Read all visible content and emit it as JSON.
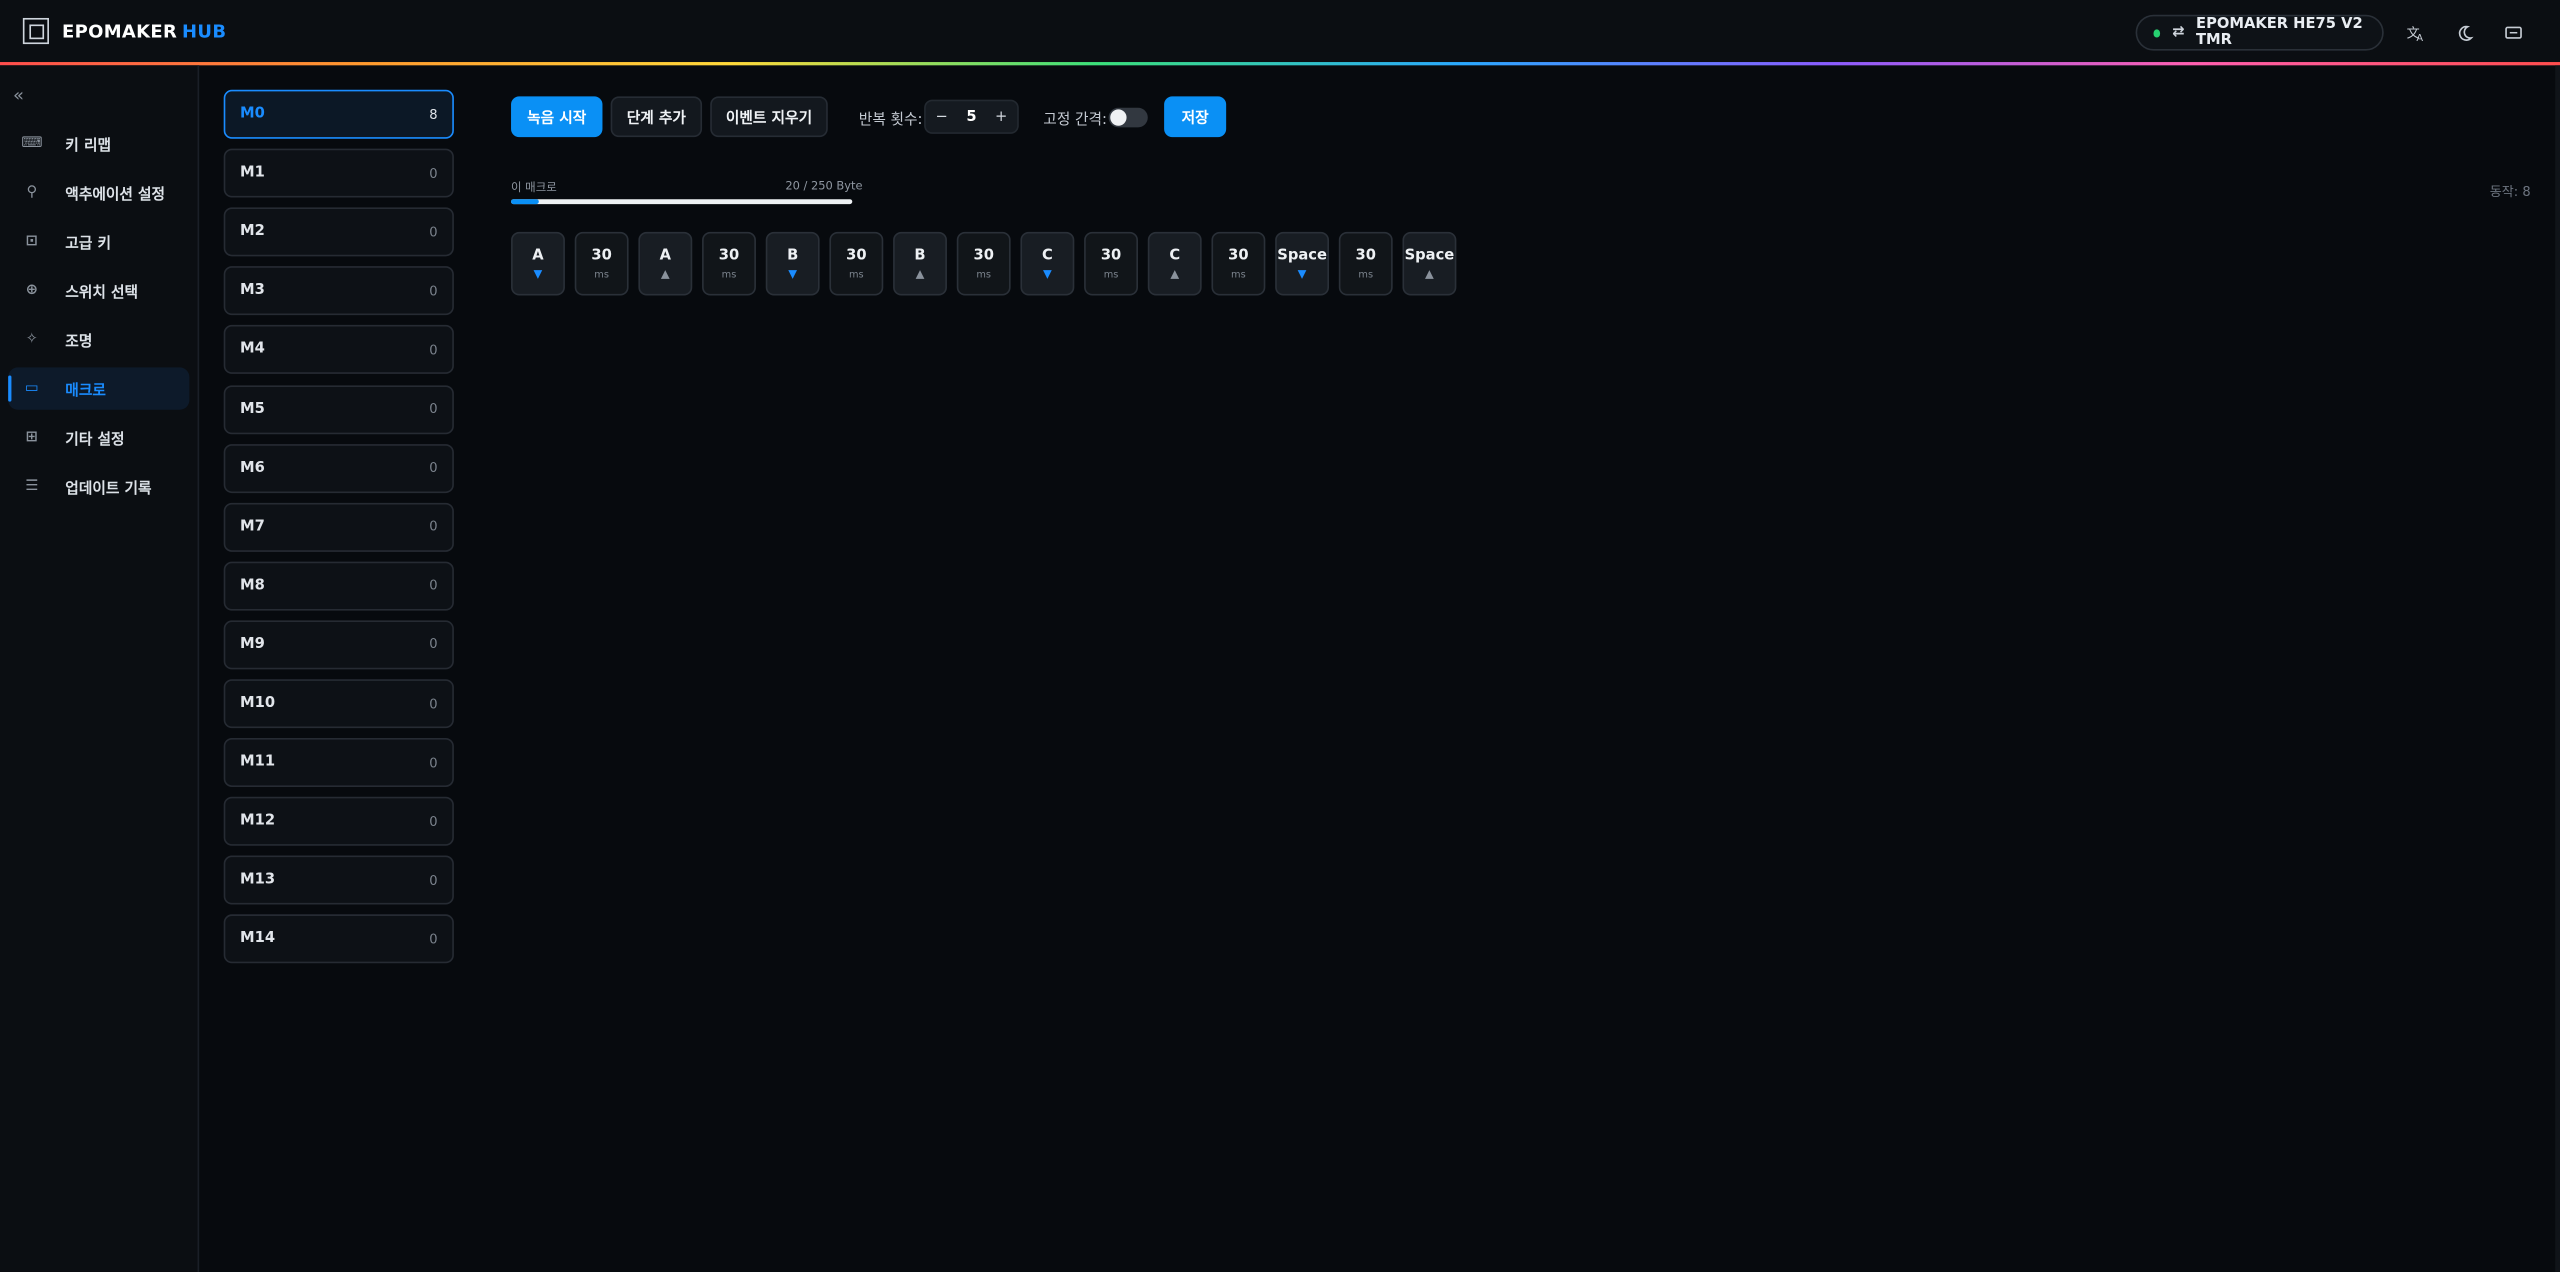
{
  "app": {
    "brand": "EPOMAKER",
    "brand_suffix": "HUB",
    "device_name": "EPOMAKER HE75 V2 TMR"
  },
  "sidebar": {
    "items": [
      {
        "label": "키 리맵",
        "icon": "keyboard-icon"
      },
      {
        "label": "액추에이션 설정",
        "icon": "actuation-icon"
      },
      {
        "label": "고급 키",
        "icon": "advanced-key-icon"
      },
      {
        "label": "스위치 선택",
        "icon": "switch-icon"
      },
      {
        "label": "조명",
        "icon": "bulb-icon"
      },
      {
        "label": "매크로",
        "icon": "macro-icon",
        "active": true
      },
      {
        "label": "기타 설정",
        "icon": "grid-icon"
      },
      {
        "label": "업데이트 기록",
        "icon": "document-icon"
      }
    ]
  },
  "macros": [
    {
      "name": "M0",
      "count": "8"
    },
    {
      "name": "M1",
      "count": "0"
    },
    {
      "name": "M2",
      "count": "0"
    },
    {
      "name": "M3",
      "count": "0"
    },
    {
      "name": "M4",
      "count": "0"
    },
    {
      "name": "M5",
      "count": "0"
    },
    {
      "name": "M6",
      "count": "0"
    },
    {
      "name": "M7",
      "count": "0"
    },
    {
      "name": "M8",
      "count": "0"
    },
    {
      "name": "M9",
      "count": "0"
    },
    {
      "name": "M10",
      "count": "0"
    },
    {
      "name": "M11",
      "count": "0"
    },
    {
      "name": "M12",
      "count": "0"
    },
    {
      "name": "M13",
      "count": "0"
    },
    {
      "name": "M14",
      "count": "0"
    }
  ],
  "toolbar": {
    "record_label": "녹음 시작",
    "add_step_label": "단계 추가",
    "clear_events_label": "이벤트 지우기",
    "repeat_label": "반복 횟수:",
    "repeat_value": "5",
    "fixed_interval_label": "고정 간격:",
    "fixed_interval_on": false,
    "save_label": "저장"
  },
  "capacity": {
    "label": "이 매크로",
    "usage_text": "20 / 250 Byte",
    "used": 20,
    "total": 250
  },
  "action_count_text": "동작: 8",
  "events": [
    {
      "type": "key",
      "key": "A",
      "dir": "down"
    },
    {
      "type": "delay",
      "value": "30",
      "unit": "ms"
    },
    {
      "type": "key",
      "key": "A",
      "dir": "up"
    },
    {
      "type": "delay",
      "value": "30",
      "unit": "ms"
    },
    {
      "type": "key",
      "key": "B",
      "dir": "down"
    },
    {
      "type": "delay",
      "value": "30",
      "unit": "ms"
    },
    {
      "type": "key",
      "key": "B",
      "dir": "up"
    },
    {
      "type": "delay",
      "value": "30",
      "unit": "ms"
    },
    {
      "type": "key",
      "key": "C",
      "dir": "down"
    },
    {
      "type": "delay",
      "value": "30",
      "unit": "ms"
    },
    {
      "type": "key",
      "key": "C",
      "dir": "up"
    },
    {
      "type": "delay",
      "value": "30",
      "unit": "ms"
    },
    {
      "type": "key",
      "key": "Space",
      "dir": "down"
    },
    {
      "type": "delay",
      "value": "30",
      "unit": "ms"
    },
    {
      "type": "key",
      "key": "Space",
      "dir": "up"
    }
  ],
  "colors": {
    "accent": "#1a8cff",
    "primary_button": "#0a90f5",
    "status_connected": "#27d070",
    "background": "#070a0e"
  }
}
